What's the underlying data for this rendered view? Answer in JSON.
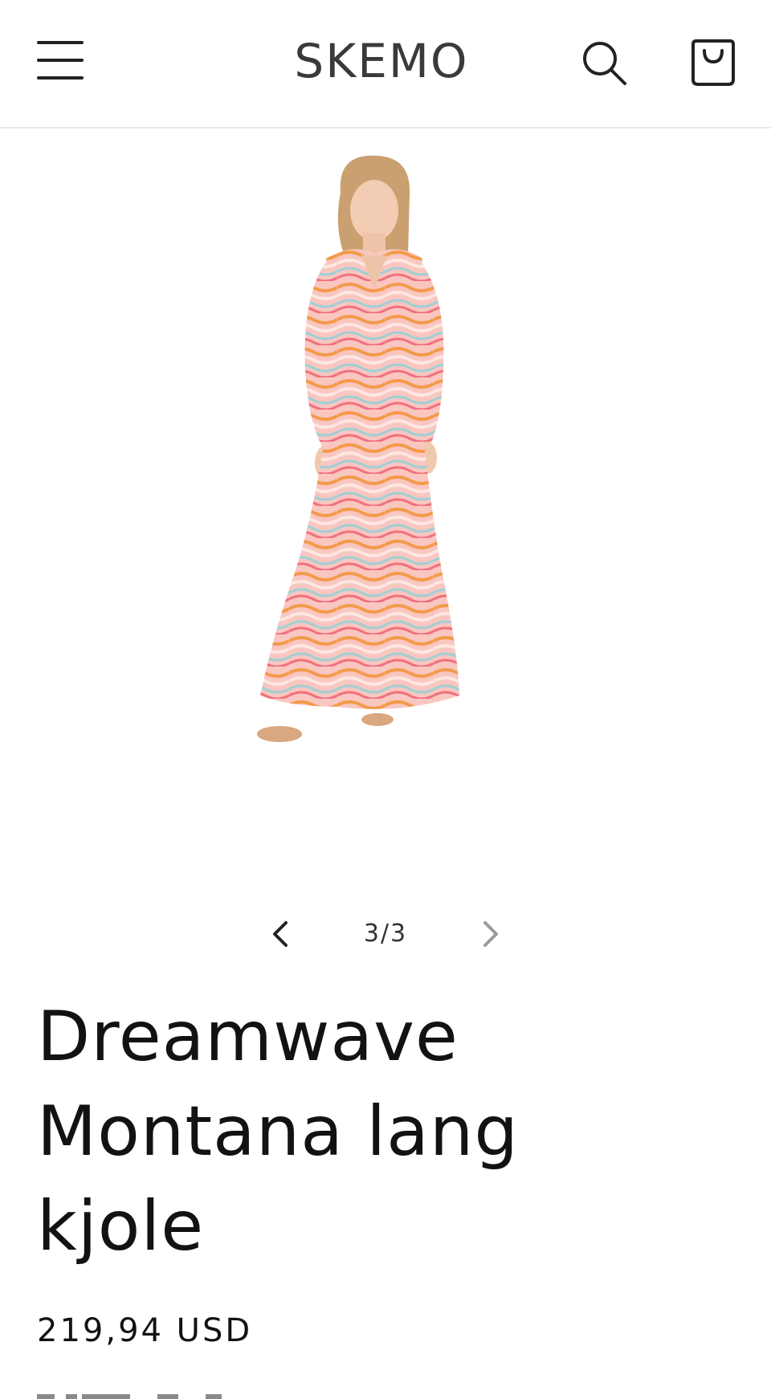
{
  "header": {
    "menu_icon": "hamburger-menu-icon",
    "logo": "SKEMO",
    "search_icon": "search-icon",
    "cart_icon": "cart-bag-icon"
  },
  "gallery": {
    "current": "3/3",
    "prev_icon": "chevron-left-icon",
    "next_icon": "chevron-right-icon"
  },
  "product": {
    "title": "Dreamwave Montana lang kjole",
    "price": "219,94 USD"
  },
  "colors": {
    "dress_pink": "#f6b3ae",
    "dress_orange": "#f39a4a",
    "text": "#121212",
    "divider": "#e8e8e8"
  }
}
